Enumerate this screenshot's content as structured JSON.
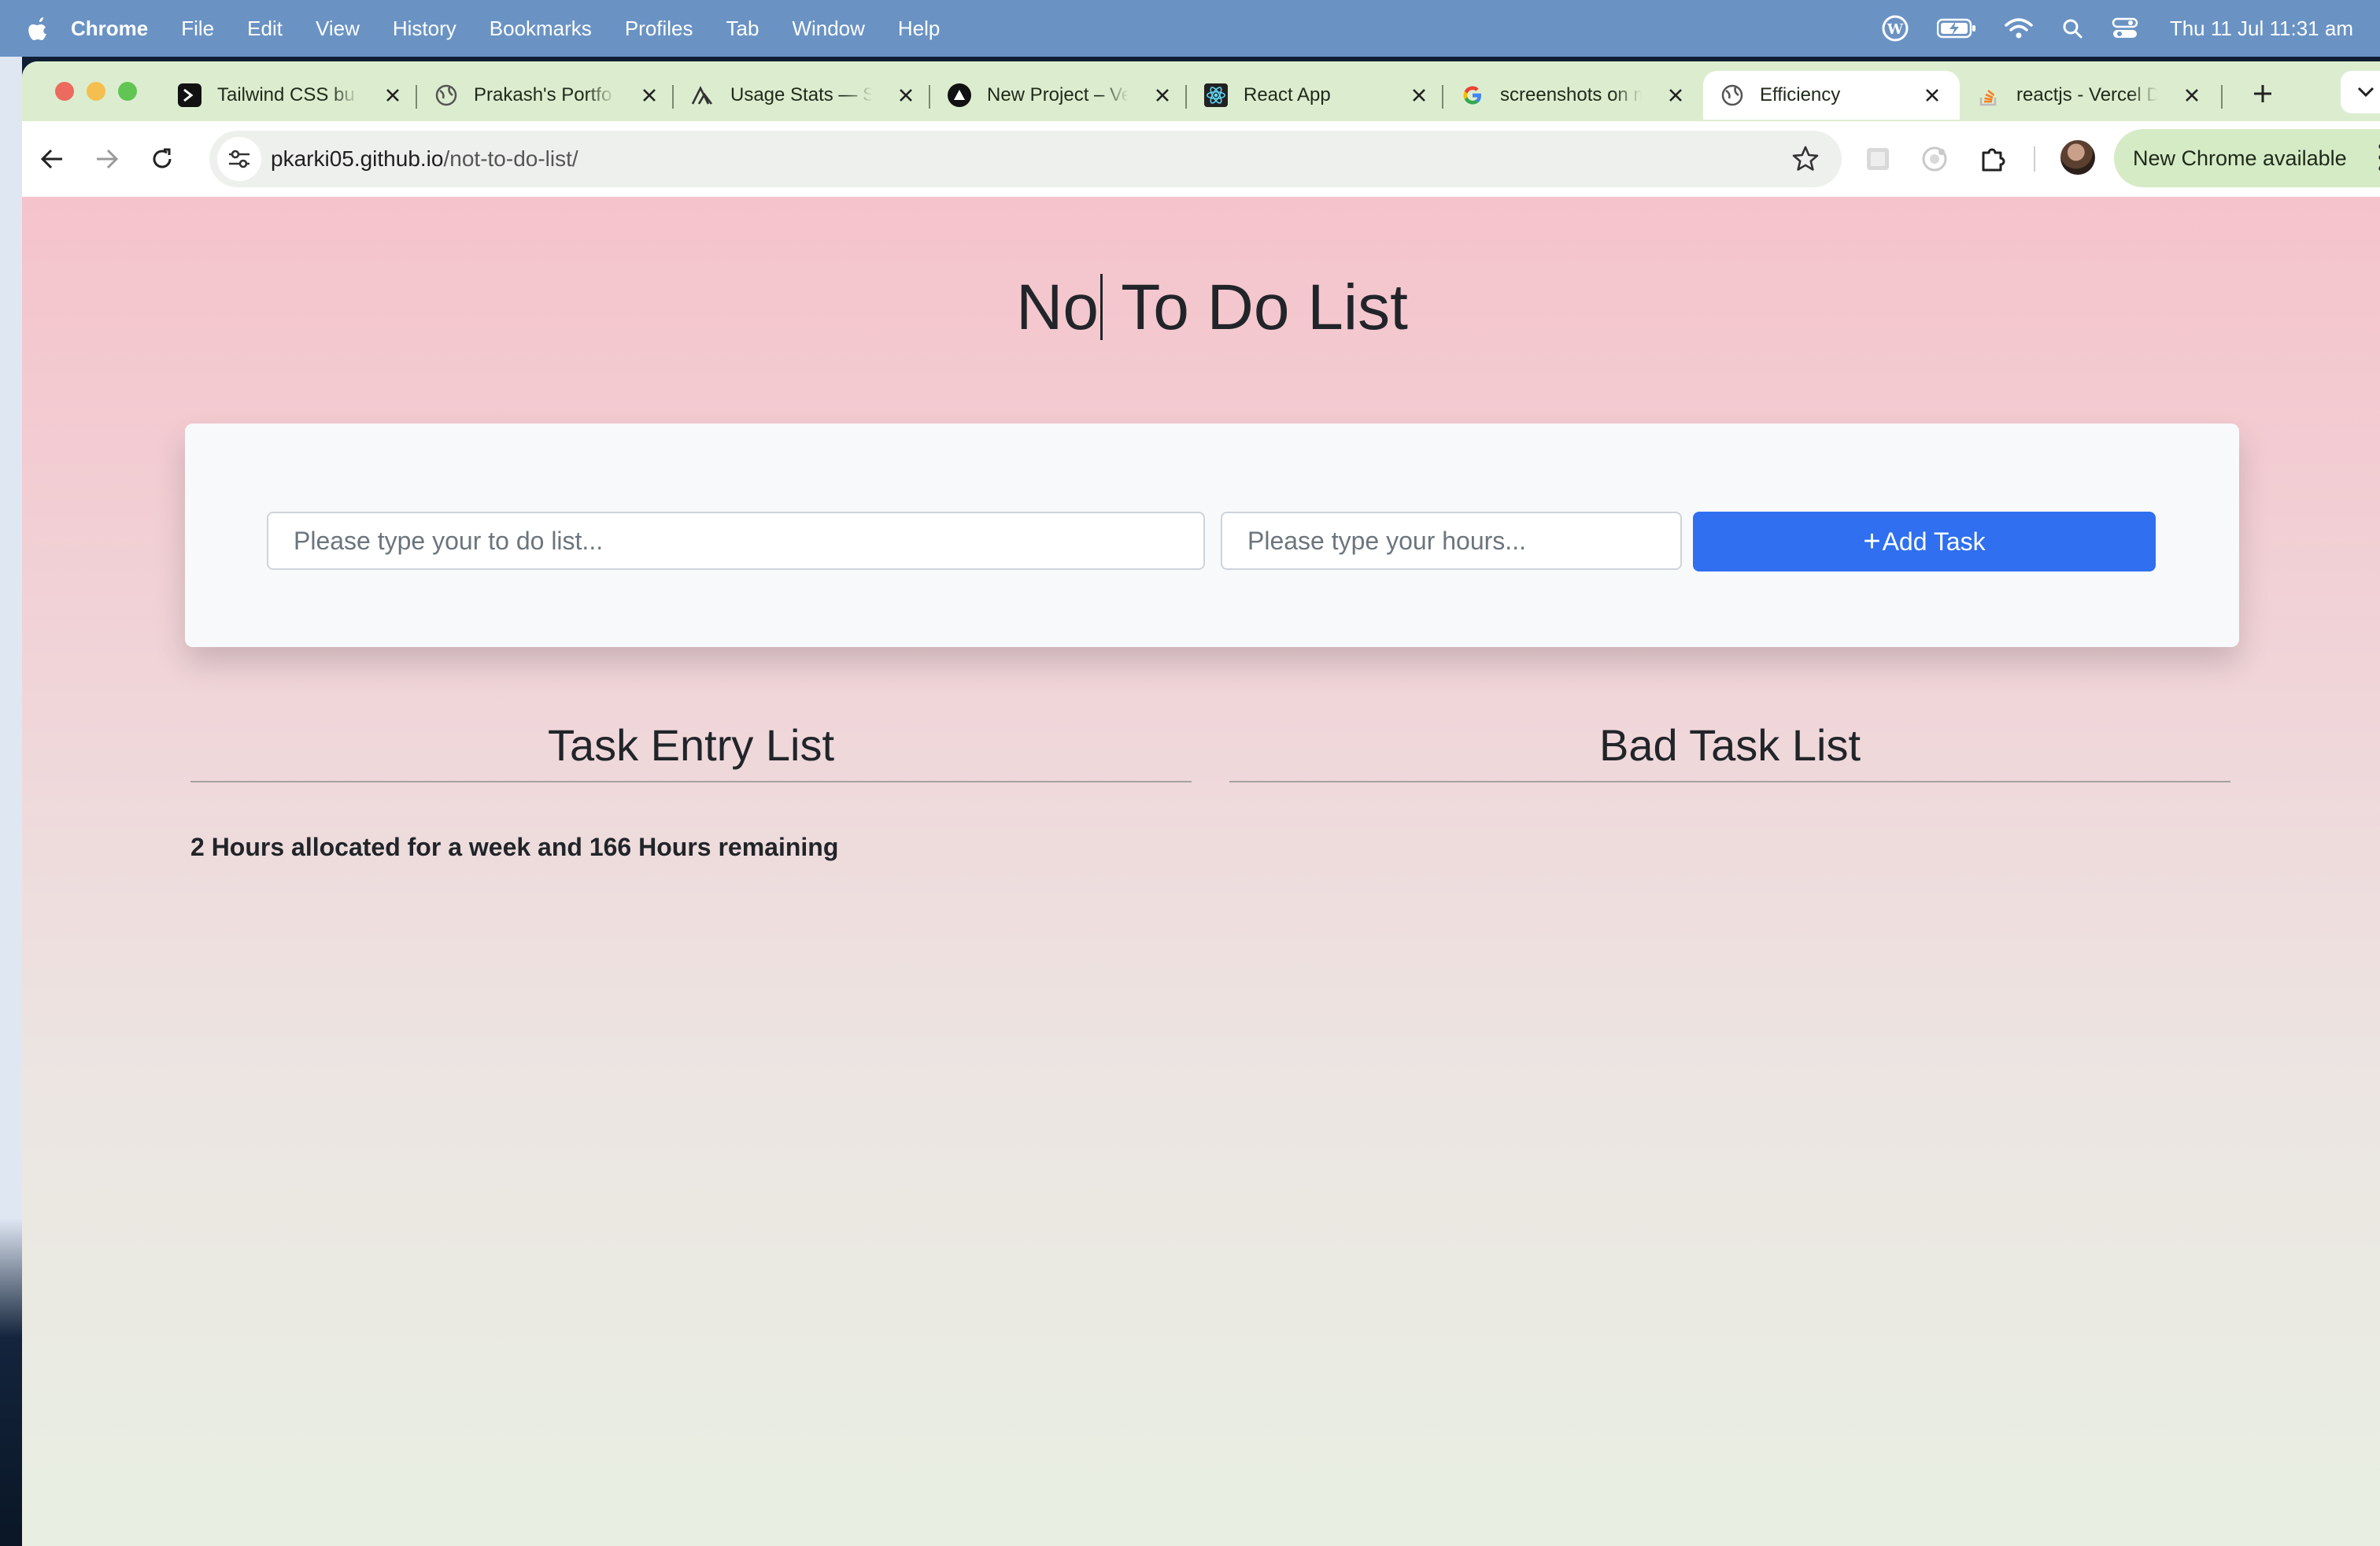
{
  "menubar": {
    "app": "Chrome",
    "items": [
      "File",
      "Edit",
      "View",
      "History",
      "Bookmarks",
      "Profiles",
      "Tab",
      "Window",
      "Help"
    ],
    "clock": "Thu 11 Jul  11:31 am"
  },
  "tabs": [
    {
      "title": "Tailwind CSS bu",
      "icon": "terminal-icon"
    },
    {
      "title": "Prakash's Portfo",
      "icon": "globe-icon"
    },
    {
      "title": "Usage Stats — S",
      "icon": "mountain-icon"
    },
    {
      "title": "New Project – Ve",
      "icon": "vercel-icon"
    },
    {
      "title": "React App",
      "icon": "react-icon"
    },
    {
      "title": "screenshots on m",
      "icon": "google-icon"
    },
    {
      "title": "Efficiency",
      "icon": "globe-icon",
      "active": true
    },
    {
      "title": "reactjs - Vercel D",
      "icon": "stackoverflow-icon"
    }
  ],
  "address": {
    "host": "pkarki05.github.io",
    "path": "/not-to-do-list/"
  },
  "new_chrome_label": "New Chrome available",
  "page": {
    "title_part1": "No",
    "title_part2": " To Do List",
    "task_placeholder": "Please type your to do list...",
    "hours_placeholder": "Please type your hours...",
    "add_label": "Add Task",
    "task_list_title": "Task Entry List",
    "bad_list_title": "Bad Task List",
    "summary": "2 Hours allocated for a week and 166 Hours remaining"
  },
  "colors": {
    "accent": "#2f6ff0",
    "menubar": "#6a93c4",
    "tabstrip": "#dcedcf"
  }
}
